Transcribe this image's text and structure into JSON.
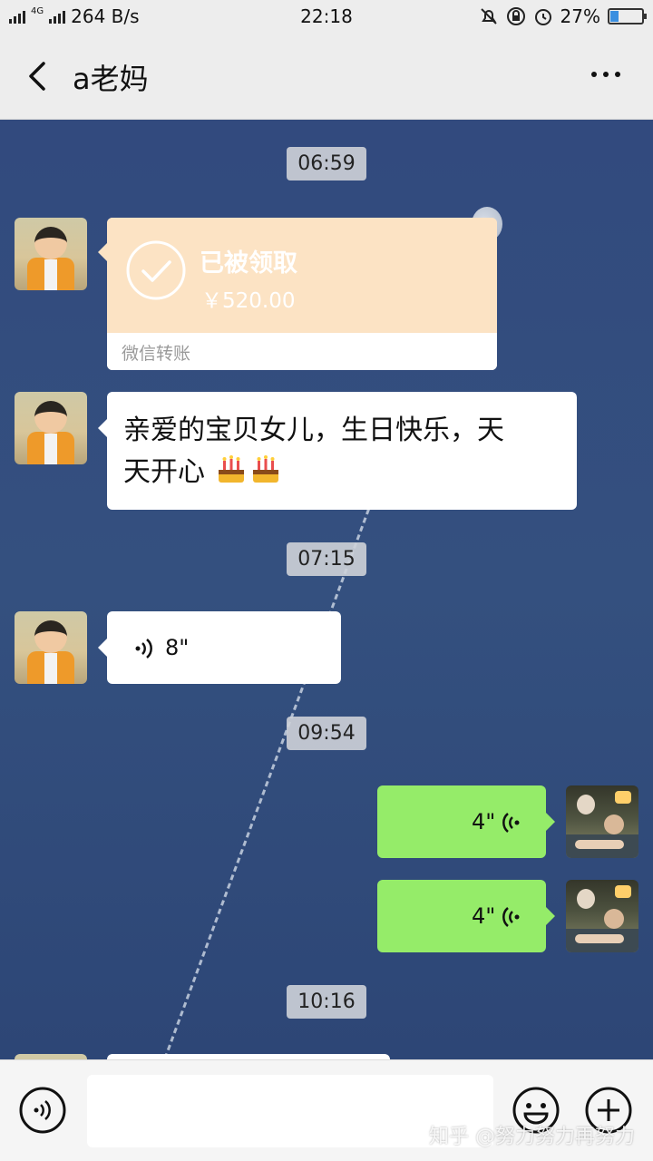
{
  "status_bar": {
    "network_speed": "264 B/s",
    "network_type": "4G",
    "time": "22:18",
    "battery": "27%",
    "battery_level": 0.27
  },
  "header": {
    "title": "a老妈",
    "icons": [
      "back-arrow-icon",
      "more-dots-icon"
    ]
  },
  "messages": [
    {
      "kind": "timestamp",
      "text": "06:59"
    },
    {
      "kind": "transfer",
      "sender": "other",
      "title": "已被领取",
      "amount": "￥520.00",
      "label": "微信转账"
    },
    {
      "kind": "text",
      "sender": "other",
      "line1": "亲爱的宝贝女儿，生日快乐，天",
      "line2": "天开心"
    },
    {
      "kind": "timestamp",
      "text": "07:15"
    },
    {
      "kind": "voice",
      "sender": "other",
      "duration": "8\""
    },
    {
      "kind": "timestamp",
      "text": "09:54"
    },
    {
      "kind": "voice",
      "sender": "me",
      "duration": "4\""
    },
    {
      "kind": "voice",
      "sender": "me",
      "duration": "4\""
    },
    {
      "kind": "timestamp",
      "text": "10:16"
    }
  ],
  "input_bar": {
    "icons": [
      "voice-input-icon",
      "emoji-icon",
      "plus-icon"
    ]
  },
  "watermark": "知乎 @努力努力再努力",
  "colors": {
    "header_bg": "#ededed",
    "chat_bg": "#324a7e",
    "green_bubble": "#95ec69",
    "transfer_card": "#fce3c4"
  }
}
